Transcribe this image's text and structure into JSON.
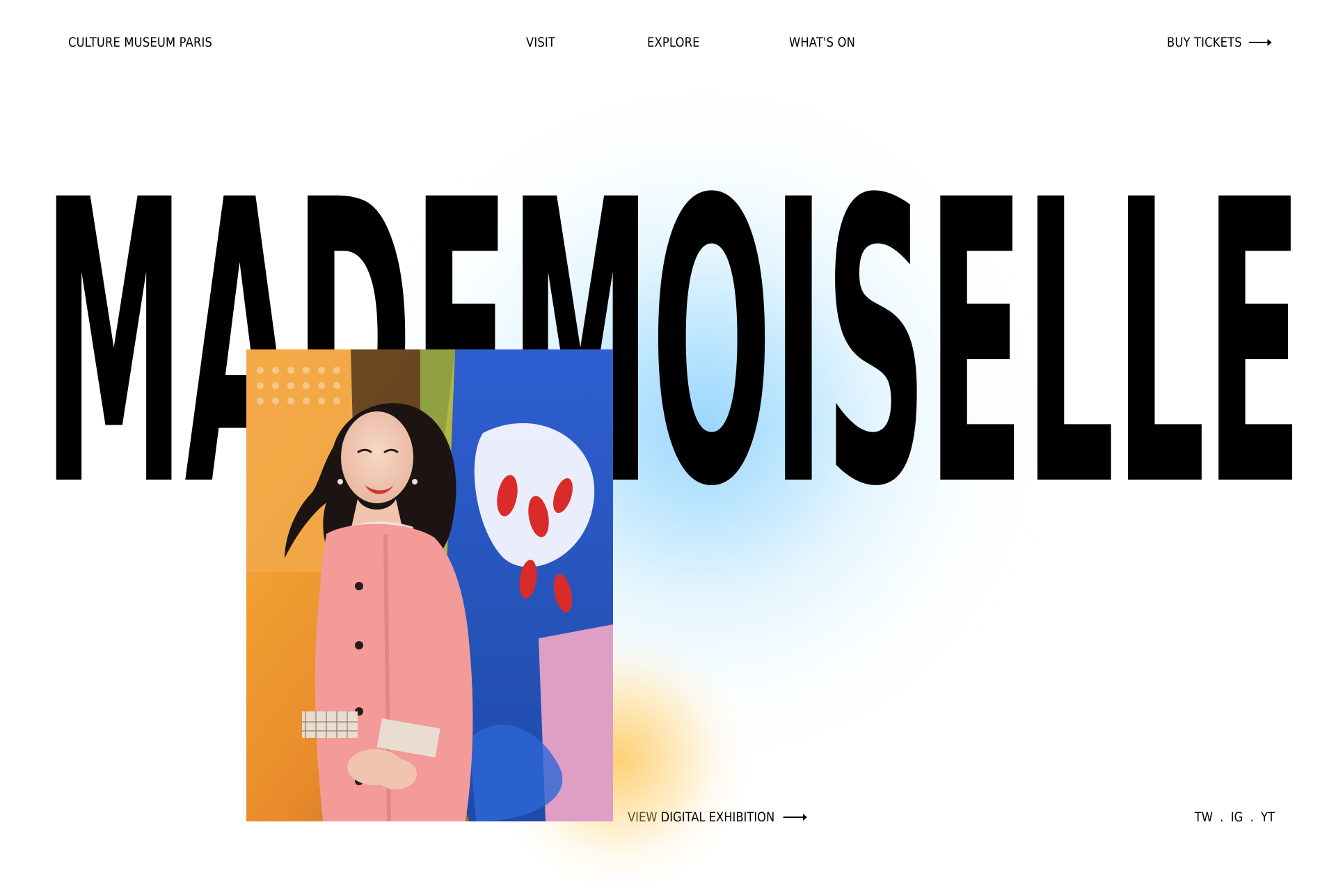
{
  "brand": "CULTURE MUSEUM PARIS",
  "nav": [
    {
      "label": "VISIT"
    },
    {
      "label": "EXPLORE"
    },
    {
      "label": "WHAT'S ON"
    }
  ],
  "buy_tickets": "BUY TICKETS",
  "headline": "MADEMOISELLE",
  "cta": {
    "part1": "VIEW",
    "part2": "DIGITAL EXHIBITION"
  },
  "social": {
    "tw": "TW",
    "ig": "IG",
    "yt": "YT",
    "separator": "."
  },
  "icons": {
    "buy_arrow": "arrow-right-icon",
    "cta_arrow": "arrow-right-icon"
  },
  "colors": {
    "background": "#ffffff",
    "text": "#000000",
    "glow_blue": "#96d4fd",
    "glow_yellow": "#ffcd6e",
    "cta_accent": "#5b4c2c"
  }
}
